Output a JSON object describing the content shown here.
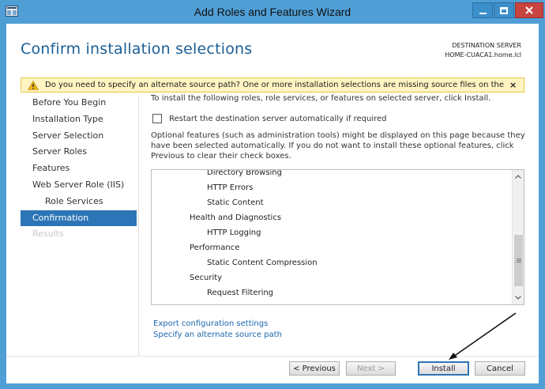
{
  "window": {
    "title": "Add Roles and Features Wizard",
    "controls": {
      "minimize": "minimize-icon",
      "maximize": "maximize-icon",
      "close": "close-icon"
    }
  },
  "page": {
    "heading": "Confirm installation selections",
    "destination_label": "DESTINATION SERVER",
    "destination_server": "HOME-CUACA1.home.lcl"
  },
  "warning": {
    "text": "Do you need to specify an alternate source path? One or more installation selections are missing source files on the destinati...",
    "close": "×",
    "icon": "warning-icon"
  },
  "nav": {
    "items": [
      {
        "label": "Before You Begin",
        "state": "normal"
      },
      {
        "label": "Installation Type",
        "state": "normal"
      },
      {
        "label": "Server Selection",
        "state": "normal"
      },
      {
        "label": "Server Roles",
        "state": "normal"
      },
      {
        "label": "Features",
        "state": "normal"
      },
      {
        "label": "Web Server Role (IIS)",
        "state": "normal"
      },
      {
        "label": "Role Services",
        "state": "sub"
      },
      {
        "label": "Confirmation",
        "state": "active"
      },
      {
        "label": "Results",
        "state": "disabled"
      }
    ]
  },
  "main": {
    "intro": "To install the following roles, role services, or features on selected server, click Install.",
    "restart_label": "Restart the destination server automatically if required",
    "restart_checked": false,
    "optional_note": "Optional features (such as administration tools) might be displayed on this page because they have been selected automatically. If you do not want to install these optional features, click Previous to clear their check boxes."
  },
  "list": {
    "items": [
      {
        "text": "Directory Browsing",
        "level": 2
      },
      {
        "text": "HTTP Errors",
        "level": 2
      },
      {
        "text": "Static Content",
        "level": 2
      },
      {
        "text": "Health and Diagnostics",
        "level": 1
      },
      {
        "text": "HTTP Logging",
        "level": 2
      },
      {
        "text": "Performance",
        "level": 1
      },
      {
        "text": "Static Content Compression",
        "level": 2
      },
      {
        "text": "Security",
        "level": 1
      },
      {
        "text": "Request Filtering",
        "level": 2
      }
    ]
  },
  "links": {
    "export": "Export configuration settings",
    "alternate_source": "Specify an alternate source path"
  },
  "buttons": {
    "previous": "< Previous",
    "next": "Next >",
    "install": "Install",
    "cancel": "Cancel"
  },
  "colors": {
    "frame": "#4f9fd6",
    "heading": "#1c5f96",
    "nav_active": "#2c75b6",
    "warning_bg": "#fff4c2",
    "link": "#1a67ad"
  }
}
